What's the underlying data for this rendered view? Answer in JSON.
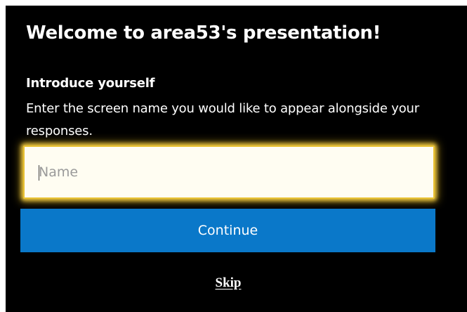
{
  "dialog": {
    "title": "Welcome to area53's presentation!",
    "subtitle": "Introduce yourself",
    "description": "Enter the screen name you would like to appear alongside your responses.",
    "name_input": {
      "value": "",
      "placeholder": "Name"
    },
    "continue_label": "Continue",
    "skip_label": "Skip"
  },
  "colors": {
    "background": "#000000",
    "text": "#ffffff",
    "button": "#0a78c9",
    "focus_glow": "#e9c233"
  }
}
